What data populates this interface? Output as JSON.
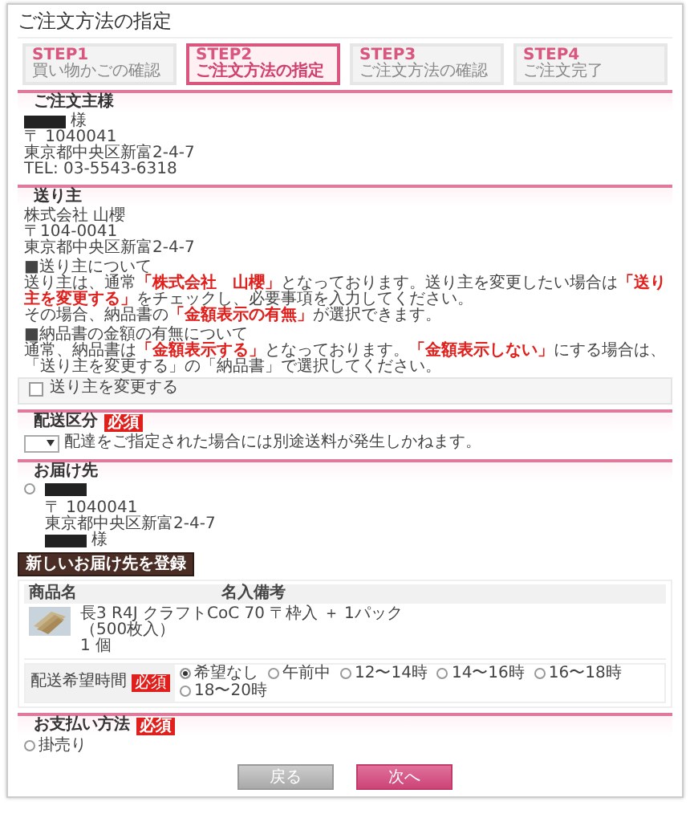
{
  "page_title": "ご注文方法の指定",
  "steps": [
    {
      "step": "STEP1",
      "label": "買い物かごの確認",
      "selected": false
    },
    {
      "step": "STEP2",
      "label": "ご注文方法の指定",
      "selected": true
    },
    {
      "step": "STEP3",
      "label": "ご注文方法の確認",
      "selected": false
    },
    {
      "step": "STEP4",
      "label": "ご注文完了",
      "selected": false
    }
  ],
  "orderer": {
    "heading": "ご注文主様",
    "honorific": "様",
    "lines": [
      "〒 1040041",
      "東京都中央区新富2-4-7",
      "TEL: 03-5543-6318"
    ]
  },
  "sender": {
    "heading": "送り主",
    "lines": [
      "株式会社 山櫻",
      "〒104-0041",
      "東京都中央区新富2-4-7"
    ],
    "notes": [
      {
        "title": "■送り主について",
        "lines": [
          "送り主は、通常**「株式会社　山櫻」**となっております。送り主を変更したい場合は**「送り主を変更する」**をチェックし、必要事項を入力してください。",
          "その場合、納品書の**「金額表示の有無」**が選択できます。"
        ]
      },
      {
        "title": "■納品書の金額の有無について",
        "lines": [
          "通常、納品書は**「金額表示する」**となっております。**「金額表示しない」**にする場合は、「送り主を変更する」の「納品書」で選択してください。"
        ]
      }
    ],
    "change_checkbox": {
      "label": "送り主を変更する",
      "checked": false
    }
  },
  "delivery_type": {
    "heading": "配送区分",
    "required": "必須",
    "note": "配達をご指定された場合には別途送料が発生しかねます。"
  },
  "destination": {
    "heading": "お届け先",
    "selected": false,
    "lines": [
      "〒 1040041",
      "東京都中央区新富2-4-7"
    ],
    "honorific": "様",
    "register_button": "新しいお届け先を登録"
  },
  "items_table": {
    "columns": [
      "商品名",
      "名入備考"
    ],
    "rows": [
      {
        "lines": [
          "長3 R4J クラフトCoC 70 〒枠入 ＋ 1パック",
          "（500枚入）",
          "1 個"
        ]
      }
    ]
  },
  "delivery_time": {
    "label": "配送希望時間",
    "required": "必須",
    "options": [
      {
        "label": "希望なし",
        "selected": true
      },
      {
        "label": "午前中",
        "selected": false
      },
      {
        "label": "12〜14時",
        "selected": false
      },
      {
        "label": "14〜16時",
        "selected": false
      },
      {
        "label": "16〜18時",
        "selected": false
      },
      {
        "label": "18〜20時",
        "selected": false
      }
    ]
  },
  "payment": {
    "heading": "お支払い方法",
    "required": "必須",
    "options": [
      {
        "label": "掛売り",
        "selected": false
      }
    ]
  },
  "buttons": {
    "back": "戻る",
    "next": "次へ"
  }
}
